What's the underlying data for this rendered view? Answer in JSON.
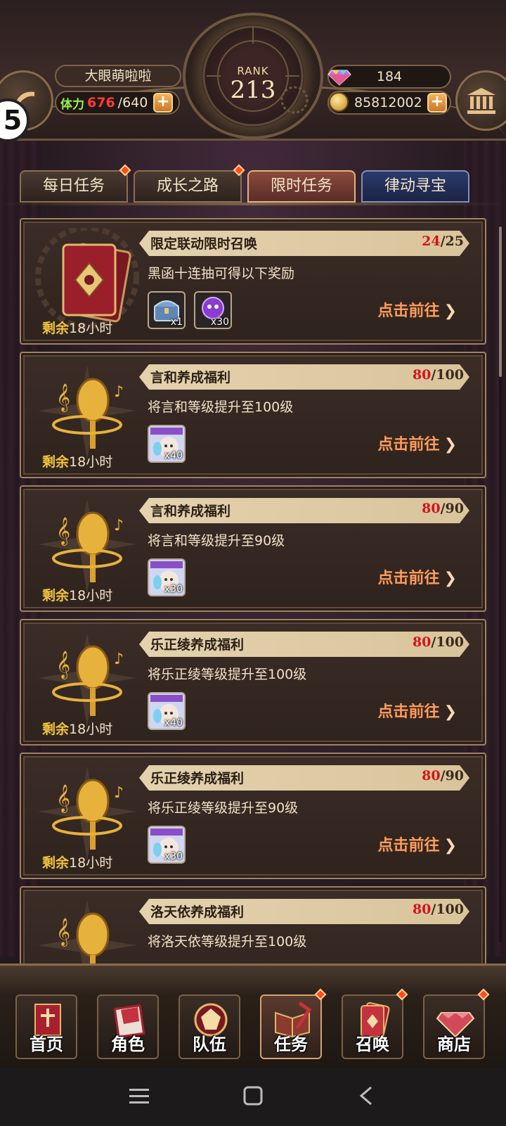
{
  "header": {
    "player_name": "大眼萌啦啦",
    "level": "5",
    "stamina_label": "体力",
    "stamina_current": "676",
    "stamina_max": "/640",
    "rank_label": "RANK",
    "rank_value": "213",
    "gems": "184",
    "coins": "85812002",
    "plus": "+"
  },
  "tabs": [
    {
      "label": "每日任务",
      "badge": true
    },
    {
      "label": "成长之路",
      "badge": true
    },
    {
      "label": "限时任务",
      "badge": false,
      "active": true
    },
    {
      "label": "律动寻宝",
      "badge": false
    }
  ],
  "tasks": [
    {
      "title": "限定联动限时召唤",
      "cur": "24",
      "max": "/25",
      "desc": "黑函十连抽可得以下奖励",
      "rewards": [
        {
          "icon": "treasure-chest-icon",
          "qty": "x1"
        },
        {
          "icon": "purple-orb-icon",
          "qty": "x30"
        }
      ],
      "remaining_a": "剩余",
      "remaining_b": "18小时",
      "go": "点击前往",
      "art": "red-card-art"
    },
    {
      "title": "言和养成福利",
      "cur": "80",
      "max": "/100",
      "desc": "将言和等级提升至100级",
      "rewards": [
        {
          "icon": "exp-material-icon",
          "qty": "x40"
        }
      ],
      "remaining_a": "剩余",
      "remaining_b": "18小时",
      "go": "点击前往",
      "art": "golden-microphone-art"
    },
    {
      "title": "言和养成福利",
      "cur": "80",
      "max": "/90",
      "desc": "将言和等级提升至90级",
      "rewards": [
        {
          "icon": "exp-material-icon",
          "qty": "x30"
        }
      ],
      "remaining_a": "剩余",
      "remaining_b": "18小时",
      "go": "点击前往",
      "art": "golden-microphone-art"
    },
    {
      "title": "乐正绫养成福利",
      "cur": "80",
      "max": "/100",
      "desc": "将乐正绫等级提升至100级",
      "rewards": [
        {
          "icon": "exp-material-icon",
          "qty": "x40"
        }
      ],
      "remaining_a": "剩余",
      "remaining_b": "18小时",
      "go": "点击前往",
      "art": "golden-microphone-art"
    },
    {
      "title": "乐正绫养成福利",
      "cur": "80",
      "max": "/90",
      "desc": "将乐正绫等级提升至90级",
      "rewards": [
        {
          "icon": "exp-material-icon",
          "qty": "x30"
        }
      ],
      "remaining_a": "剩余",
      "remaining_b": "18小时",
      "go": "点击前往",
      "art": "golden-microphone-art"
    },
    {
      "title": "洛天依养成福利",
      "cur": "80",
      "max": "/100",
      "desc": "将洛天依等级提升至100级",
      "rewards": [],
      "remaining_a": "",
      "remaining_b": "",
      "go": "",
      "art": "golden-microphone-art"
    }
  ],
  "nav": [
    {
      "label": "首页",
      "icon": "home-banner-icon",
      "badge": false
    },
    {
      "label": "角色",
      "icon": "character-icon",
      "badge": false
    },
    {
      "label": "队伍",
      "icon": "team-icon",
      "badge": false
    },
    {
      "label": "任务",
      "icon": "task-book-icon",
      "badge": true,
      "active": true
    },
    {
      "label": "召唤",
      "icon": "summon-card-icon",
      "badge": true
    },
    {
      "label": "商店",
      "icon": "shop-gem-icon",
      "badge": true
    }
  ],
  "colors": {
    "accent": "#ff9c5c",
    "progress_red": "#d4141b",
    "gold": "#f2c53d",
    "stamina_green": "#9cf24a"
  }
}
